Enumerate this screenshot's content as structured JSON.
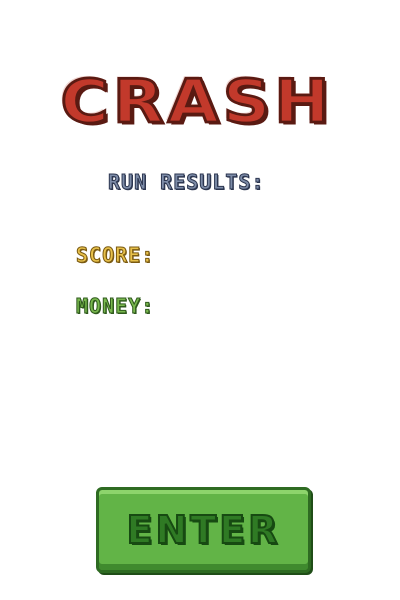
{
  "title": "CRASH",
  "run_results_label": "RUN RESULTS:",
  "score_label": "SCORE:",
  "money_label": "MONEY:",
  "enter_label": "ENTER",
  "colors": {
    "title": "#c2392b",
    "title_outline": "#5a1a12",
    "run_results": "#7d8ca8",
    "score": "#e7c04a",
    "money": "#79b84e",
    "button": "#62b447",
    "button_text": "#2f7a24"
  }
}
